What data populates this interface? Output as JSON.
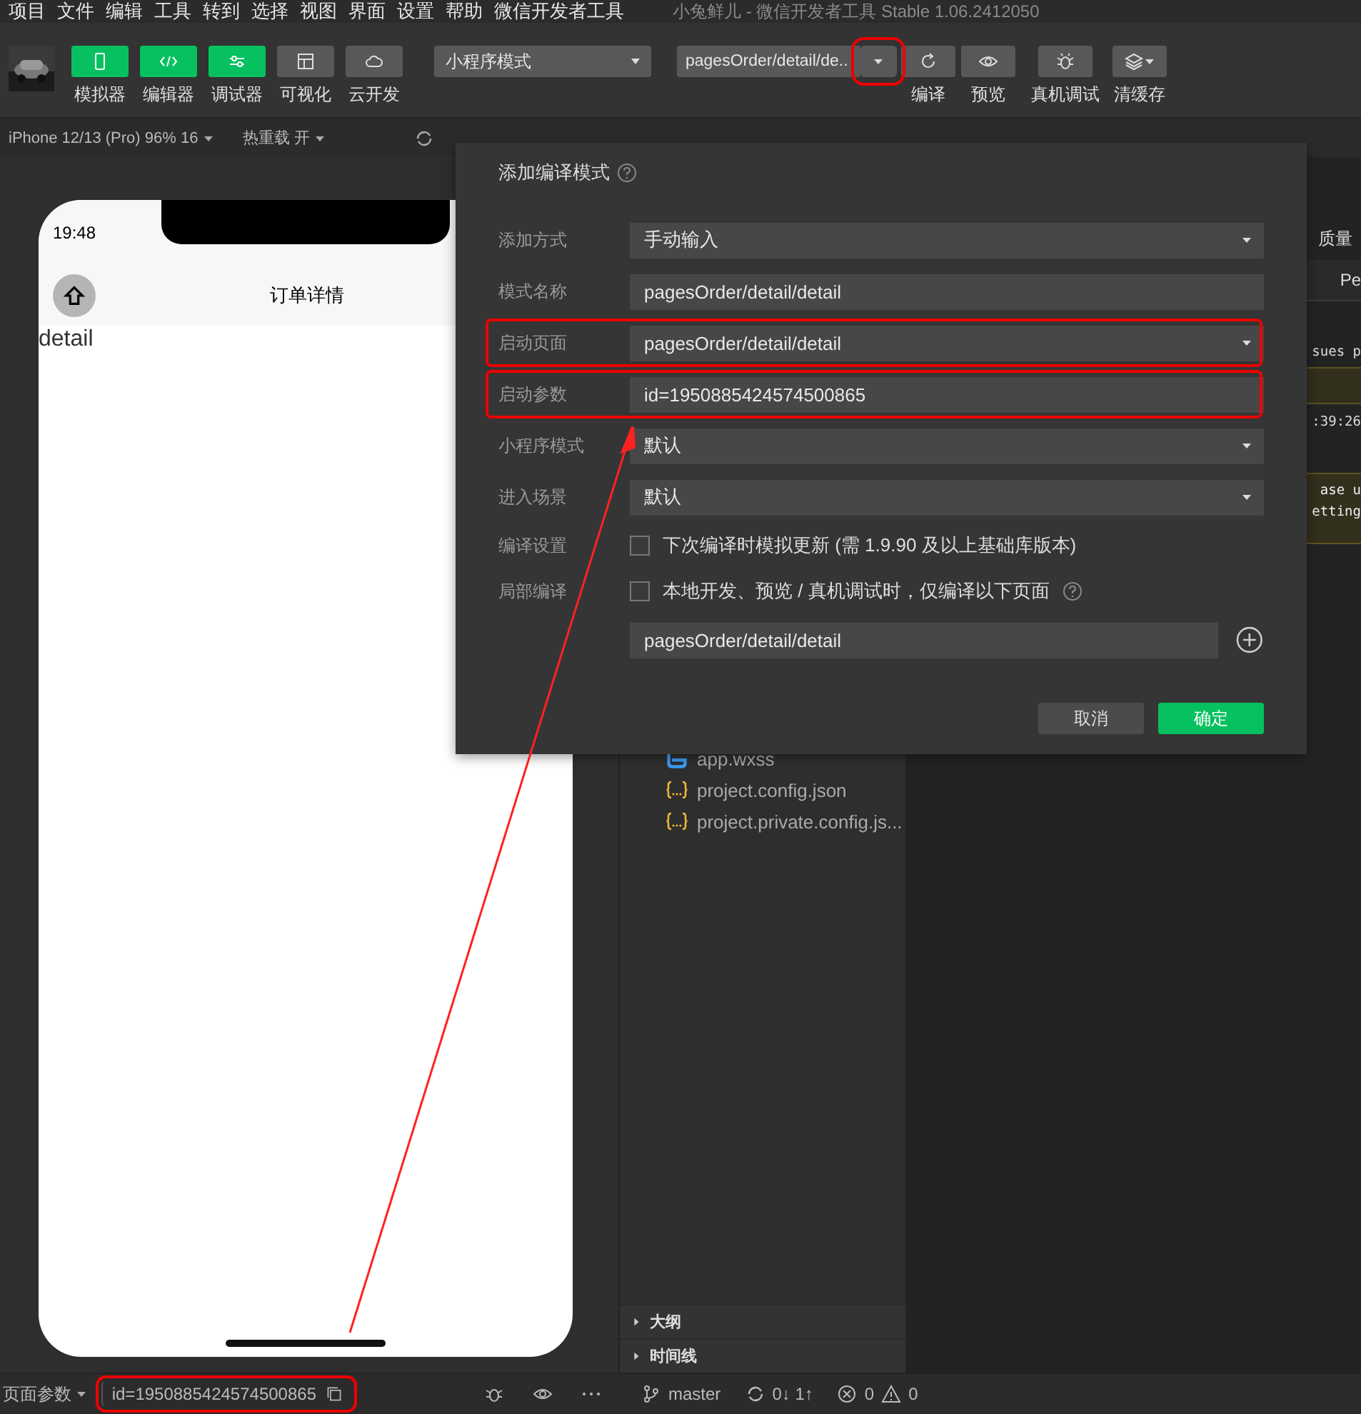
{
  "menu_bar": {
    "items": [
      "项目",
      "文件",
      "编辑",
      "工具",
      "转到",
      "选择",
      "视图",
      "界面",
      "设置",
      "帮助",
      "微信开发者工具"
    ],
    "title": "小兔鲜儿 - 微信开发者工具 Stable 1.06.2412050"
  },
  "toolbar": {
    "tool_buttons": [
      {
        "label": "模拟器",
        "on": true
      },
      {
        "label": "编辑器",
        "on": true
      },
      {
        "label": "调试器",
        "on": true
      },
      {
        "label": "可视化",
        "on": false
      },
      {
        "label": "云开发",
        "on": false
      }
    ],
    "mode_select": "小程序模式",
    "compile_select": {
      "value": "pagesOrder/detail/de..",
      "highlighted": true
    },
    "actions": [
      "编译",
      "预览",
      "真机调试",
      "清缓存"
    ]
  },
  "simulator_bar": {
    "device": "iPhone 12/13 (Pro) 96% 16",
    "hot_reload": "热重载 开"
  },
  "phone": {
    "time": "19:48",
    "nav_title": "订单详情",
    "page_text": "detail"
  },
  "dialog": {
    "title": "添加编译模式",
    "rows": [
      {
        "kind": "select",
        "label": "添加方式",
        "value": "手动输入",
        "highlighted": false
      },
      {
        "kind": "input",
        "label": "模式名称",
        "value": "pagesOrder/detail/detail",
        "highlighted": false
      },
      {
        "kind": "select",
        "label": "启动页面",
        "value": "pagesOrder/detail/detail",
        "highlighted": true
      },
      {
        "kind": "input",
        "label": "启动参数",
        "value": "id=1950885424574500865",
        "highlighted": true
      },
      {
        "kind": "select",
        "label": "小程序模式",
        "value": "默认",
        "highlighted": false
      },
      {
        "kind": "select",
        "label": "进入场景",
        "value": "默认",
        "highlighted": false
      },
      {
        "kind": "checkbox",
        "label": "编译设置",
        "text": "下次编译时模拟更新 (需 1.9.90 及以上基础库版本)",
        "checked": false,
        "help": false,
        "highlighted": false
      },
      {
        "kind": "checkbox",
        "label": "局部编译",
        "text": "本地开发、预览 / 真机调试时，仅编译以下页面",
        "checked": false,
        "help": true,
        "highlighted": false
      },
      {
        "kind": "page",
        "value": "pagesOrder/detail/detail",
        "highlighted": false
      }
    ],
    "buttons": [
      {
        "label": "取消",
        "kind": "secondary"
      },
      {
        "label": "确定",
        "kind": "primary"
      }
    ]
  },
  "file_tree": [
    {
      "name": "app.wxss",
      "kind": "style"
    },
    {
      "name": "project.config.json",
      "kind": "json"
    },
    {
      "name": "project.private.config.js...",
      "kind": "json"
    }
  ],
  "sections": [
    {
      "label": "大纲",
      "expanded": false
    },
    {
      "label": "时间线",
      "expanded": false
    }
  ],
  "right_panel": [
    {
      "kind": "tab",
      "text": "质量"
    },
    {
      "kind": "tab",
      "text": "Pe"
    },
    {
      "kind": "code",
      "text": "sues p"
    },
    {
      "kind": "warning"
    },
    {
      "kind": "code",
      "text": ":39:26"
    },
    {
      "kind": "warning",
      "text": "ase u\netting"
    }
  ],
  "status_bar": {
    "page_params_label": "页面参数",
    "page_params": {
      "value": "id=1950885424574500865",
      "highlighted": true
    },
    "branch": "master",
    "sync": "0↓ 1↑",
    "errors": "0",
    "warnings": "0"
  }
}
